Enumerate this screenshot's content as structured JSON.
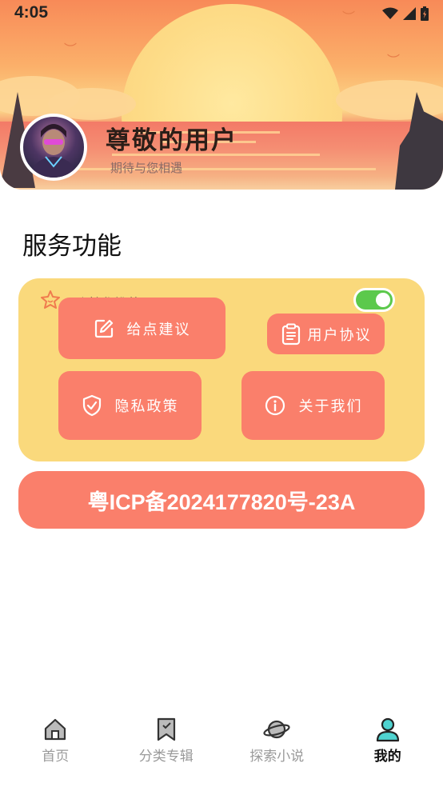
{
  "status_bar": {
    "time": "4:05"
  },
  "profile": {
    "name": "尊敬的用户",
    "subtitle": "期待与您相遇"
  },
  "section": {
    "title": "服务功能"
  },
  "personalized": {
    "label": "个性化推荐",
    "enabled": true,
    "toggle_color": "#5cc94c"
  },
  "buttons": {
    "feedback": {
      "label": "给点建议",
      "icon": "edit-icon"
    },
    "agreement": {
      "label": "用户协议",
      "icon": "clipboard-icon"
    },
    "privacy": {
      "label": "隐私政策",
      "icon": "shield-check-icon"
    },
    "about": {
      "label": "关于我们",
      "icon": "info-icon"
    }
  },
  "icp": {
    "text": "粤ICP备2024177820号-23A"
  },
  "tabbar": {
    "items": [
      {
        "label": "首页",
        "icon": "home-icon",
        "active": false
      },
      {
        "label": "分类专辑",
        "icon": "bookmark-icon",
        "active": false
      },
      {
        "label": "探索小说",
        "icon": "planet-icon",
        "active": false
      },
      {
        "label": "我的",
        "icon": "user-icon",
        "active": true
      }
    ]
  },
  "colors": {
    "accent": "#fa7f6b",
    "panel": "#fad97c",
    "active_tab_icon": "#4fd3d0"
  }
}
